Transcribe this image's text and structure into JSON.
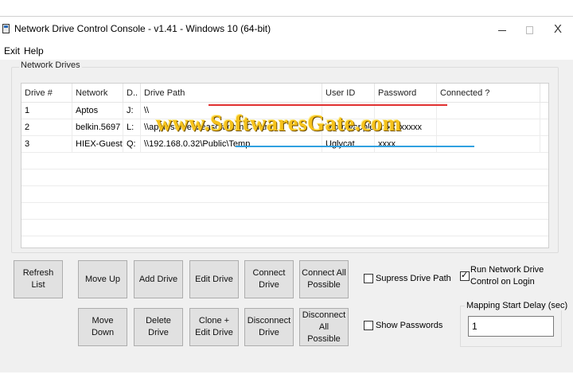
{
  "window": {
    "title": "Network Drive Control Console - v1.41 - Windows 10  (64-bit)",
    "controls": {
      "minimize": "min",
      "maximize": "max",
      "close": "X"
    }
  },
  "menu": {
    "exit": "Exit",
    "help": "Help"
  },
  "group": {
    "label": "Network Drives"
  },
  "table": {
    "headers": {
      "drive": "Drive #",
      "network": "Network",
      "d": "D..",
      "path": "Drive Path",
      "user": "User ID",
      "password": "Password",
      "connected": "Connected ?"
    },
    "rows": [
      {
        "drive": "1",
        "network": "Aptos",
        "d": "J:",
        "path": "\\\\",
        "user": "",
        "password": "",
        "connected": ""
      },
      {
        "drive": "2",
        "network": "belkin.5697",
        "d": "L:",
        "path": "\\\\appleserver.zeasoft.com\\Central",
        "user": "Wormyapples",
        "password": "xxxxxxxxxx",
        "connected": ""
      },
      {
        "drive": "3",
        "network": "HIEX-Guest",
        "d": "Q:",
        "path": "\\\\192.168.0.32\\Public\\Temp",
        "user": "Uglycat",
        "password": "xxxx",
        "connected": ""
      }
    ]
  },
  "buttons": {
    "refresh": "Refresh List",
    "move_up": "Move Up",
    "move_down": "Move Down",
    "add": "Add Drive",
    "delete": "Delete Drive",
    "edit": "Edit Drive",
    "clone_edit": "Clone + Edit Drive",
    "connect": "Connect Drive",
    "disconnect": "Disconnect Drive",
    "connect_all": "Connect All Possible",
    "disconnect_all": "Disconnect All Possible"
  },
  "options": {
    "suppress_path": {
      "label": "Supress Drive Path",
      "checked": false
    },
    "show_passwords": {
      "label": "Show Passwords",
      "checked": false
    },
    "run_on_login": {
      "label": "Run Network Drive Control on Login",
      "checked": true
    }
  },
  "delay": {
    "label": "Mapping Start Delay (sec)",
    "value": "1"
  },
  "watermark": {
    "text": "www.SoftwaresGate.com"
  }
}
